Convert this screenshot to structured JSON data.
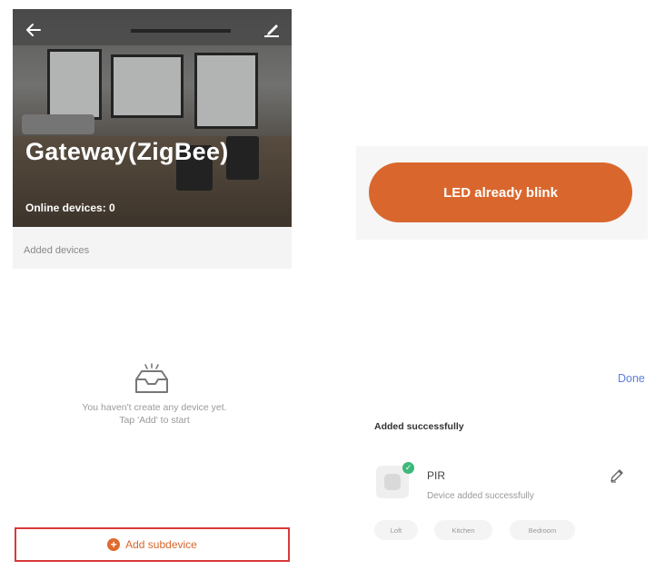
{
  "gateway": {
    "title": "Gateway(ZigBee)",
    "online_devices": "Online devices: 0",
    "added_devices_label": "Added devices",
    "empty_line1": "You haven't create any device yet.",
    "empty_line2": "Tap 'Add' to start",
    "add_subdevice_label": "Add subdevice"
  },
  "led": {
    "button_label": "LED already blink"
  },
  "result": {
    "done_label": "Done",
    "heading": "Added successfully",
    "device_name": "PIR",
    "device_status": "Device added successfully",
    "rooms": [
      "Loft",
      "Kitchen",
      "Bedroom"
    ]
  },
  "colors": {
    "accent_orange": "#d9672d",
    "highlight_red": "#d83a3a",
    "done_blue": "#5b7de0",
    "success_green": "#3cb878"
  },
  "icons": [
    "back-arrow-icon",
    "edit-icon",
    "empty-box-icon",
    "plus-icon",
    "check-icon",
    "pencil-icon"
  ]
}
